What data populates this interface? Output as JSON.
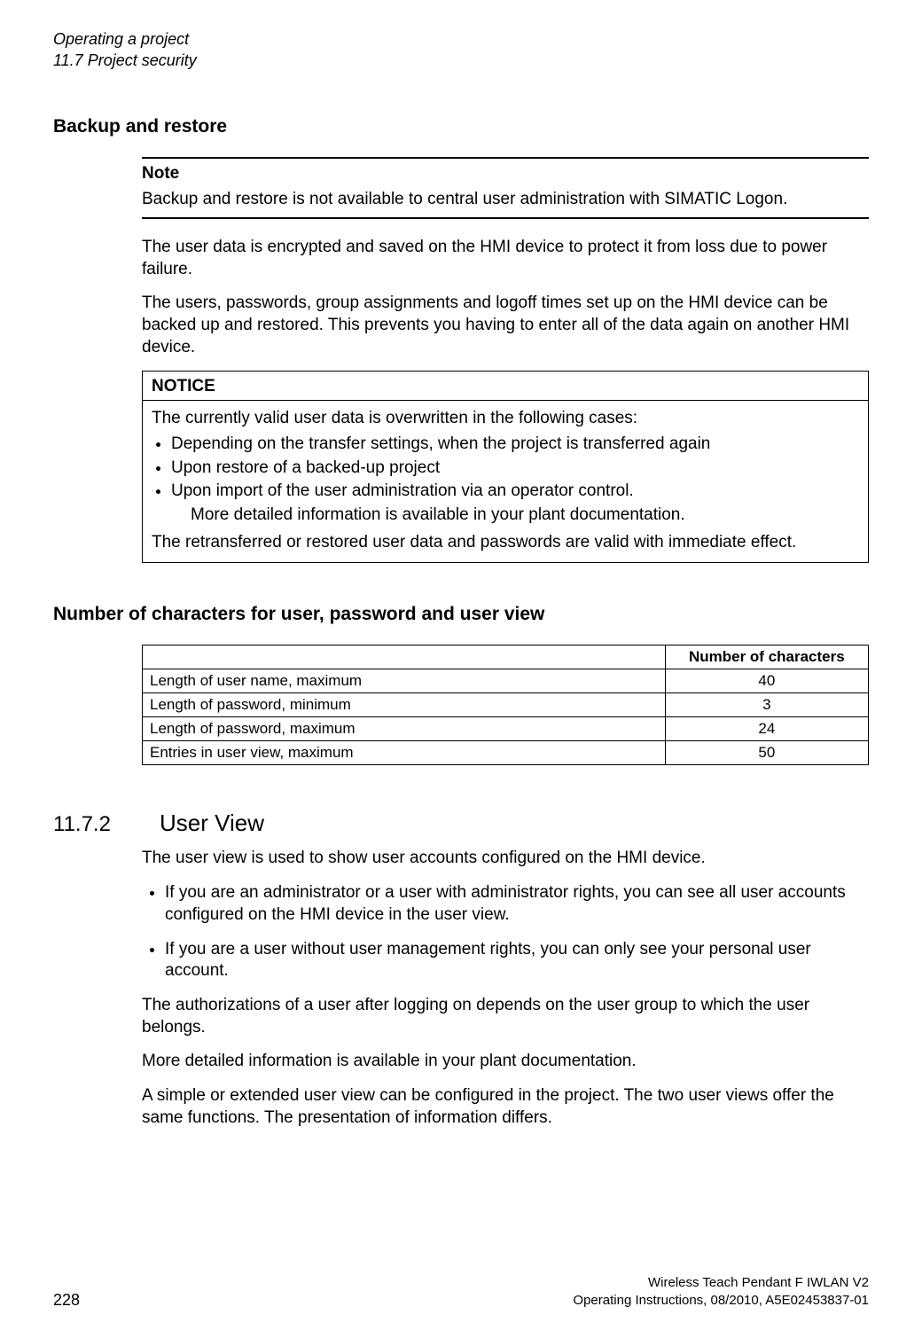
{
  "running_head": {
    "line1": "Operating a project",
    "line2": "11.7 Project security"
  },
  "backup": {
    "heading": "Backup and restore",
    "note_label": "Note",
    "note_text": "Backup and restore is not available to central user administration with SIMATIC Logon.",
    "para1": "The user data is encrypted and saved on the HMI device to protect it from loss due to power failure.",
    "para2": "The users, passwords, group assignments and logoff times set up on the HMI device can be backed up and restored. This prevents you having to enter all of the data again on another HMI device.",
    "notice_label": "NOTICE",
    "notice_intro": "The currently valid user data is overwritten in the following cases:",
    "notice_items": {
      "i1": "Depending on the transfer settings, when the project is transferred again",
      "i2": "Upon restore of a backed-up project",
      "i3": "Upon import of the user administration via an operator control.",
      "i3_sub": "More detailed information is available in your plant documentation."
    },
    "notice_out": "The retransferred or restored user data and passwords are valid with immediate effect."
  },
  "chars": {
    "heading": "Number of characters for user, password and user view",
    "col_header": "Number of characters",
    "rows": {
      "r1_label": "Length of user name, maximum",
      "r1_val": "40",
      "r2_label": "Length of password, minimum",
      "r2_val": "3",
      "r3_label": "Length of password, maximum",
      "r3_val": "24",
      "r4_label": "Entries in user view, maximum",
      "r4_val": "50"
    }
  },
  "chart_data": {
    "type": "table",
    "title": "Number of characters for user, password and user view",
    "columns": [
      "",
      "Number of characters"
    ],
    "rows": [
      [
        "Length of user name, maximum",
        40
      ],
      [
        "Length of password, minimum",
        3
      ],
      [
        "Length of password, maximum",
        24
      ],
      [
        "Entries in user view, maximum",
        50
      ]
    ]
  },
  "userview": {
    "section_num": "11.7.2",
    "section_title": "User View",
    "para1": "The user view is used to show user accounts configured on the HMI device.",
    "li1": "If you are an administrator or a user with administrator rights, you can see all user accounts configured on the HMI device in the user view.",
    "li2": "If you are a user without user management rights, you can only see your personal user account.",
    "para2": "The authorizations of a user after logging on depends on the user group to which the user belongs.",
    "para3": "More detailed information is available in your plant documentation.",
    "para4": "A simple or extended user view can be configured in the project. The two user views offer the same functions. The presentation of information differs."
  },
  "footer": {
    "page_num": "228",
    "right1": "Wireless Teach Pendant F IWLAN V2",
    "right2": "Operating Instructions, 08/2010, A5E02453837-01"
  }
}
